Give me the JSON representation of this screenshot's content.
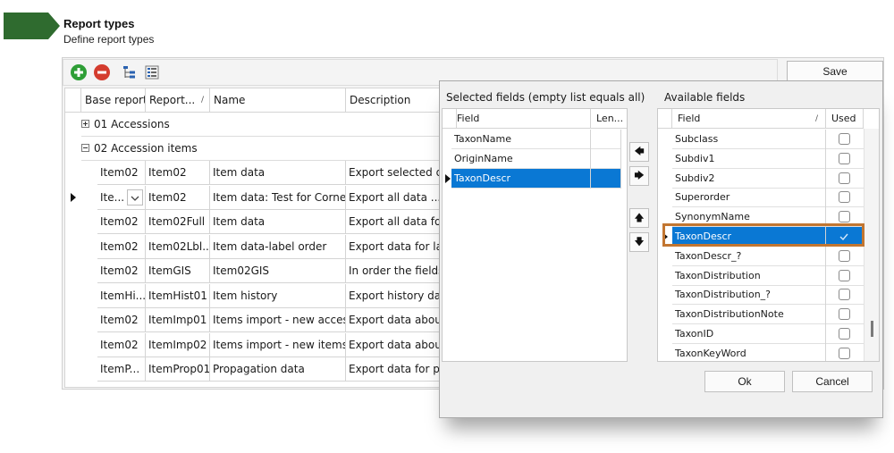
{
  "header": {
    "title": "Report types",
    "subtitle": "Define report types"
  },
  "toolbar": {
    "save_label": "Save"
  },
  "grid": {
    "columns": [
      "Base report",
      "Report...",
      "Name",
      "Description"
    ],
    "groups": [
      {
        "label": "01 Accessions",
        "expanded": false
      },
      {
        "label": "02 Accession items",
        "expanded": true
      }
    ],
    "rows": [
      {
        "base": "Item02",
        "report": "Item02",
        "name": "Item data",
        "desc": "Export selected da..."
      },
      {
        "base": "Ite...",
        "report": "Item02",
        "name": "Item data: Test for Cornell",
        "desc": "Export all data ..."
      },
      {
        "base": "Item02",
        "report": "Item02Full",
        "name": "Item data",
        "desc": "Export all data for..."
      },
      {
        "base": "Item02",
        "report": "Item02Lbl...",
        "name": "Item data-label order",
        "desc": "Export data for la..."
      },
      {
        "base": "Item02",
        "report": "ItemGIS",
        "name": "Item02GIS",
        "desc": "In order the fields ..."
      },
      {
        "base": "ItemHi...",
        "report": "ItemHist01",
        "name": "Item history",
        "desc": "Export history dat..."
      },
      {
        "base": "Item02",
        "report": "ItemImp01",
        "name": "Items import - new acces...",
        "desc": "Export data about..."
      },
      {
        "base": "Item02",
        "report": "ItemImp02",
        "name": "Items import - new items",
        "desc": "Export data about..."
      },
      {
        "base": "ItemP...",
        "report": "ItemProp01",
        "name": "Propagation data",
        "desc": "Export data for pr..."
      }
    ]
  },
  "dialog": {
    "selected_title": "Selected fields (empty list equals all)",
    "available_title": "Available fields",
    "selected_columns": [
      "Field",
      "Len..."
    ],
    "selected_fields": [
      "TaxonName",
      "OriginName",
      "TaxonDescr"
    ],
    "available_columns": [
      "Field",
      "Used"
    ],
    "available_fields": [
      {
        "name": "Subclass",
        "used": false
      },
      {
        "name": "Subdiv1",
        "used": false
      },
      {
        "name": "Subdiv2",
        "used": false
      },
      {
        "name": "Superorder",
        "used": false
      },
      {
        "name": "SynonymName",
        "used": false
      },
      {
        "name": "TaxonDescr",
        "used": true
      },
      {
        "name": "TaxonDescr_?",
        "used": false
      },
      {
        "name": "TaxonDistribution",
        "used": false
      },
      {
        "name": "TaxonDistribution_?",
        "used": false
      },
      {
        "name": "TaxonDistributionNote",
        "used": false
      },
      {
        "name": "TaxonID",
        "used": false
      },
      {
        "name": "TaxonKeyWord",
        "used": false
      }
    ],
    "ok_label": "Ok",
    "cancel_label": "Cancel"
  },
  "colors": {
    "header_arrow": "#2f6b2f",
    "selection": "#0a78d4",
    "highlight": "#c27631",
    "add": "#2e9e36",
    "remove": "#d43c2e"
  }
}
